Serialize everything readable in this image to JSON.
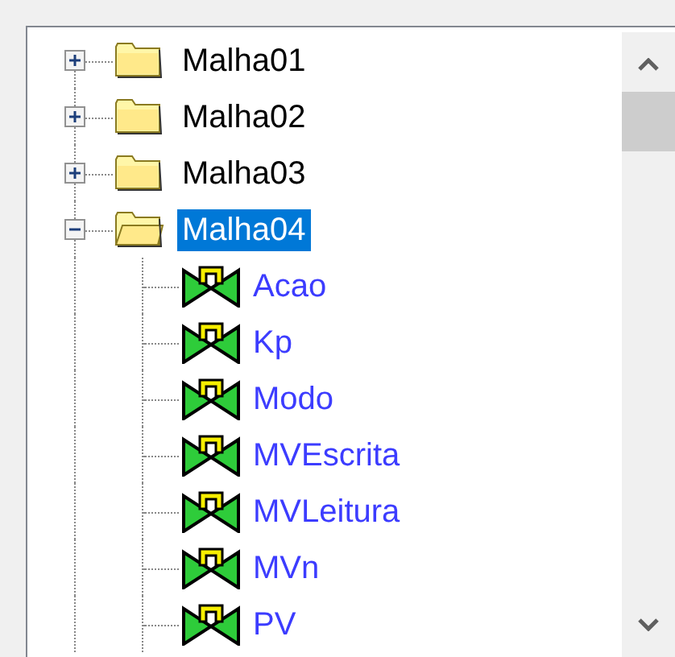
{
  "tree": {
    "items": [
      {
        "kind": "folder",
        "label": "Malha01",
        "expanded": false,
        "selected": false
      },
      {
        "kind": "folder",
        "label": "Malha02",
        "expanded": false,
        "selected": false
      },
      {
        "kind": "folder",
        "label": "Malha03",
        "expanded": false,
        "selected": false
      },
      {
        "kind": "folder",
        "label": "Malha04",
        "expanded": true,
        "selected": true,
        "children": [
          {
            "kind": "tag",
            "label": "Acao",
            "selected": false
          },
          {
            "kind": "tag",
            "label": "Kp",
            "selected": false
          },
          {
            "kind": "tag",
            "label": "Modo",
            "selected": false
          },
          {
            "kind": "tag",
            "label": "MVEscrita",
            "selected": false
          },
          {
            "kind": "tag",
            "label": "MVLeitura",
            "selected": false
          },
          {
            "kind": "tag",
            "label": "MVn",
            "selected": false
          },
          {
            "kind": "tag",
            "label": "PV",
            "selected": false
          }
        ]
      }
    ]
  }
}
